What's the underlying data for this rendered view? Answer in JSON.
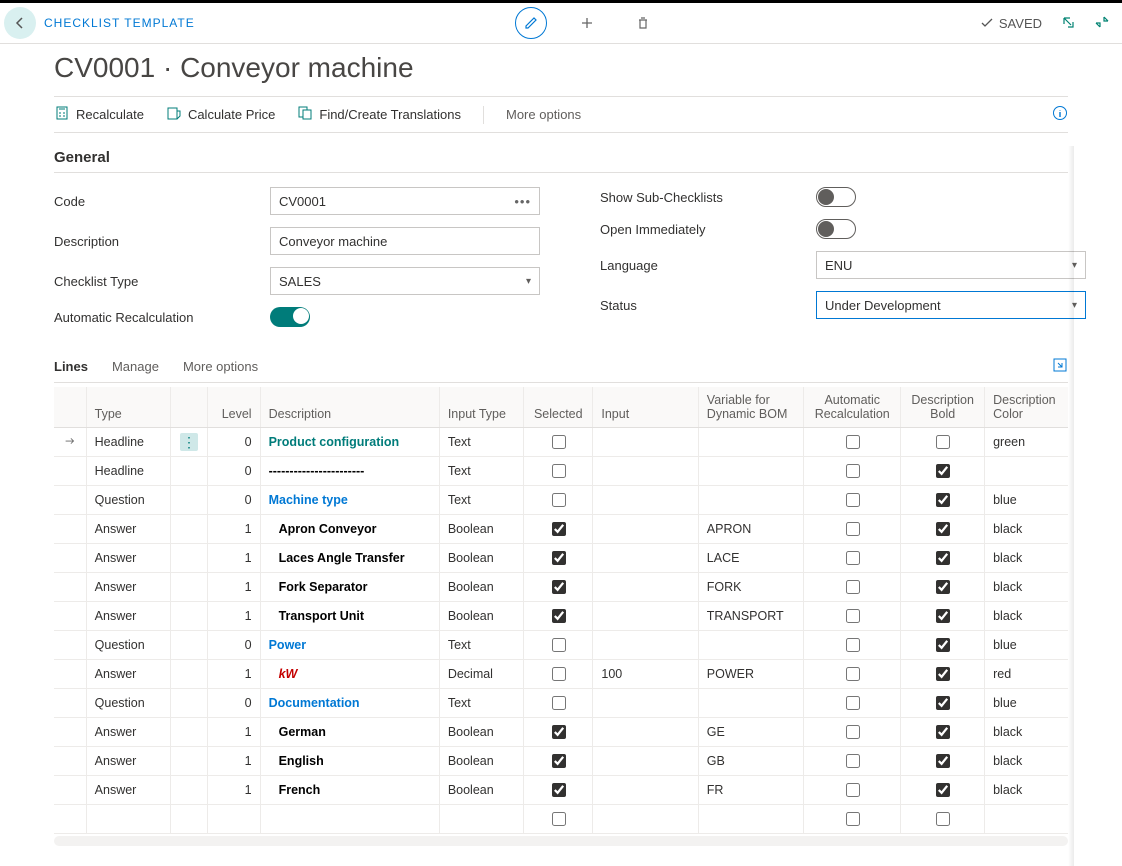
{
  "breadcrumb": "CHECKLIST TEMPLATE",
  "page_title": "CV0001 · Conveyor machine",
  "saved_label": "SAVED",
  "actions": {
    "recalculate": "Recalculate",
    "calc_price": "Calculate Price",
    "find_trans": "Find/Create Translations",
    "more": "More options"
  },
  "section": {
    "general": "General"
  },
  "fields": {
    "code_label": "Code",
    "code_value": "CV0001",
    "desc_label": "Description",
    "desc_value": "Conveyor machine",
    "ctype_label": "Checklist Type",
    "ctype_value": "SALES",
    "autorec_label": "Automatic Recalculation",
    "showsub_label": "Show Sub-Checklists",
    "openimm_label": "Open Immediately",
    "lang_label": "Language",
    "lang_value": "ENU",
    "status_label": "Status",
    "status_value": "Under Development"
  },
  "lines_tabs": {
    "lines": "Lines",
    "manage": "Manage",
    "more": "More options"
  },
  "columns": {
    "type": "Type",
    "level": "Level",
    "desc": "Description",
    "itype": "Input Type",
    "sel": "Selected",
    "input": "Input",
    "var": "Variable for Dynamic BOM",
    "auto": "Automatic Recalculation",
    "bold": "Description Bold",
    "color": "Description Color"
  },
  "rows": [
    {
      "arrow": true,
      "menu": true,
      "type": "Headline",
      "level": 0,
      "desc": "Product configuration",
      "dclass": "desc-green",
      "indent": 0,
      "itype": "Text",
      "sel": false,
      "input": "",
      "var": "",
      "auto": false,
      "bold": false,
      "color": "green"
    },
    {
      "type": "Headline",
      "level": 0,
      "desc": "-----------------------",
      "dclass": "desc-black-b",
      "indent": 0,
      "itype": "Text",
      "sel": false,
      "input": "",
      "var": "",
      "auto": false,
      "bold": true,
      "color": ""
    },
    {
      "type": "Question",
      "level": 0,
      "desc": "Machine type",
      "dclass": "desc-blue",
      "indent": 0,
      "itype": "Text",
      "sel": false,
      "input": "",
      "var": "",
      "auto": false,
      "bold": true,
      "color": "blue"
    },
    {
      "type": "Answer",
      "level": 1,
      "desc": "Apron Conveyor",
      "dclass": "desc-black-b",
      "indent": 1,
      "itype": "Boolean",
      "sel": true,
      "input": "",
      "var": "APRON",
      "auto": false,
      "bold": true,
      "color": "black"
    },
    {
      "type": "Answer",
      "level": 1,
      "desc": "Laces Angle Transfer",
      "dclass": "desc-black-b",
      "indent": 1,
      "itype": "Boolean",
      "sel": true,
      "input": "",
      "var": "LACE",
      "auto": false,
      "bold": true,
      "color": "black"
    },
    {
      "type": "Answer",
      "level": 1,
      "desc": "Fork Separator",
      "dclass": "desc-black-b",
      "indent": 1,
      "itype": "Boolean",
      "sel": true,
      "input": "",
      "var": "FORK",
      "auto": false,
      "bold": true,
      "color": "black"
    },
    {
      "type": "Answer",
      "level": 1,
      "desc": "Transport Unit",
      "dclass": "desc-black-b",
      "indent": 1,
      "itype": "Boolean",
      "sel": true,
      "input": "",
      "var": "TRANSPORT",
      "auto": false,
      "bold": true,
      "color": "black"
    },
    {
      "type": "Question",
      "level": 0,
      "desc": "Power",
      "dclass": "desc-blue",
      "indent": 0,
      "itype": "Text",
      "sel": false,
      "input": "",
      "var": "",
      "auto": false,
      "bold": true,
      "color": "blue"
    },
    {
      "type": "Answer",
      "level": 1,
      "desc": "kW",
      "dclass": "desc-red-bi",
      "indent": 1,
      "itype": "Decimal",
      "sel": false,
      "input": "100",
      "var": "POWER",
      "auto": false,
      "bold": true,
      "color": "red"
    },
    {
      "type": "Question",
      "level": 0,
      "desc": "Documentation",
      "dclass": "desc-blue",
      "indent": 0,
      "itype": "Text",
      "sel": false,
      "input": "",
      "var": "",
      "auto": false,
      "bold": true,
      "color": "blue"
    },
    {
      "type": "Answer",
      "level": 1,
      "desc": "German",
      "dclass": "desc-black-b",
      "indent": 1,
      "itype": "Boolean",
      "sel": true,
      "input": "",
      "var": "GE",
      "auto": false,
      "bold": true,
      "color": "black"
    },
    {
      "type": "Answer",
      "level": 1,
      "desc": "English",
      "dclass": "desc-black-b",
      "indent": 1,
      "itype": "Boolean",
      "sel": true,
      "input": "",
      "var": "GB",
      "auto": false,
      "bold": true,
      "color": "black"
    },
    {
      "type": "Answer",
      "level": 1,
      "desc": "French",
      "dclass": "desc-black-b",
      "indent": 1,
      "itype": "Boolean",
      "sel": true,
      "input": "",
      "var": "FR",
      "auto": false,
      "bold": true,
      "color": "black"
    },
    {
      "type": "",
      "level": "",
      "desc": "",
      "dclass": "",
      "indent": 0,
      "itype": "",
      "sel": false,
      "input": "",
      "var": "",
      "auto": false,
      "bold": false,
      "color": ""
    }
  ]
}
